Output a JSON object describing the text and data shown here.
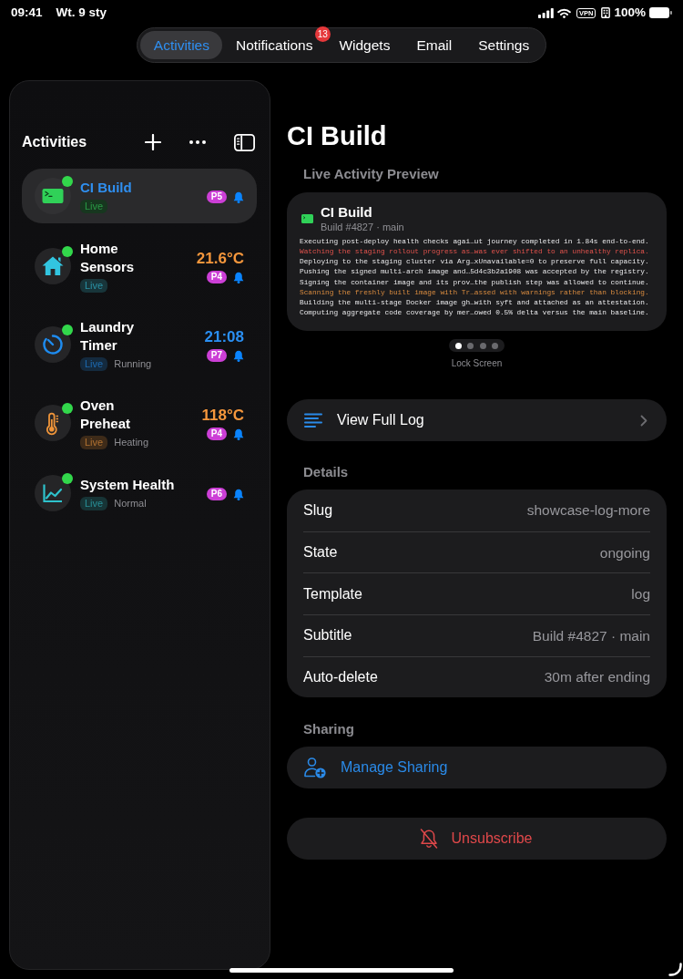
{
  "status_bar": {
    "time": "09:41",
    "date": "Wt. 9 sty",
    "vpn": "VPN",
    "battery": "100%"
  },
  "tabs": [
    {
      "label": "Activities",
      "selected": true
    },
    {
      "label": "Notifications",
      "selected": false,
      "badge": "13"
    },
    {
      "label": "Widgets",
      "selected": false
    },
    {
      "label": "Email",
      "selected": false
    },
    {
      "label": "Settings",
      "selected": false
    }
  ],
  "sidebar": {
    "title": "Activities",
    "items": [
      {
        "title": "CI Build",
        "selected": true,
        "kind": "log",
        "color": "#30d158",
        "online": true,
        "tag": "Live",
        "priority": "P5",
        "notify": true
      },
      {
        "title": "Home Sensors",
        "selected": false,
        "kind": "home",
        "color": "#32c5e0",
        "online": true,
        "tag": "Live",
        "value": {
          "text": "21.6°C",
          "color": "#f5973c"
        },
        "priority": "P4",
        "notify": true
      },
      {
        "title": "Laundry Timer",
        "selected": false,
        "kind": "timer",
        "color": "#1e8cf0",
        "online": true,
        "tag": "Live",
        "status": "Running",
        "value": {
          "text": "21:08",
          "color": "#2a8ff2"
        },
        "priority": "P7",
        "notify": true
      },
      {
        "title": "Oven Preheat",
        "selected": false,
        "kind": "thermometer",
        "color": "#f0953a",
        "online": true,
        "tag": "Live",
        "status": "Heating",
        "value": {
          "text": "118°C",
          "color": "#f5973c"
        },
        "priority": "P4",
        "notify": true
      },
      {
        "title": "System Health",
        "selected": false,
        "kind": "chart",
        "color": "#2ec2cc",
        "online": true,
        "tag": "Live",
        "status": "Normal",
        "priority": "P6",
        "notify": true
      }
    ]
  },
  "detail": {
    "title": "CI Build",
    "preview": {
      "heading": "Live Activity Preview",
      "title": "CI Build",
      "subtitle": "Build #4827 · main",
      "lines": [
        {
          "kind": "info",
          "text": "Executing post-deploy health checks agai…ut journey completed in 1.84s end-to-end."
        },
        {
          "kind": "error",
          "text": "Watching the staging rollout progress as…was ever shifted to an unhealthy replica."
        },
        {
          "kind": "info",
          "text": "Deploying to the staging cluster via Arg…xUnavailable=0 to preserve full capacity."
        },
        {
          "kind": "info",
          "text": "Pushing the signed multi-arch image and…5d4c3b2a1908 was accepted by the registry."
        },
        {
          "kind": "info",
          "text": "Signing the container image and its prov…the publish step was allowed to continue."
        },
        {
          "kind": "warning",
          "text": "Scanning the freshly built image with Tr…assed with warnings rather than blocking."
        },
        {
          "kind": "info",
          "text": "Building the multi-stage Docker image gh…with syft and attached as an attestation."
        },
        {
          "kind": "info",
          "text": "Computing aggregate code coverage by mer…owed 0.5% delta versus the main baseline."
        }
      ],
      "pages": [
        {
          "selected": true
        },
        {
          "selected": false
        },
        {
          "selected": false
        },
        {
          "selected": false
        }
      ],
      "page_label": "Lock Screen"
    },
    "view_log": "View Full Log",
    "details": {
      "heading": "Details",
      "rows": [
        {
          "label": "Slug",
          "value": "showcase-log-more"
        },
        {
          "label": "State",
          "value": "ongoing"
        },
        {
          "label": "Template",
          "value": "log"
        },
        {
          "label": "Subtitle",
          "value": "Build #4827 · main"
        },
        {
          "label": "Auto-delete",
          "value": "30m after ending"
        }
      ]
    },
    "sharing": {
      "heading": "Sharing",
      "button": "Manage Sharing"
    },
    "unsubscribe": "Unsubscribe"
  }
}
